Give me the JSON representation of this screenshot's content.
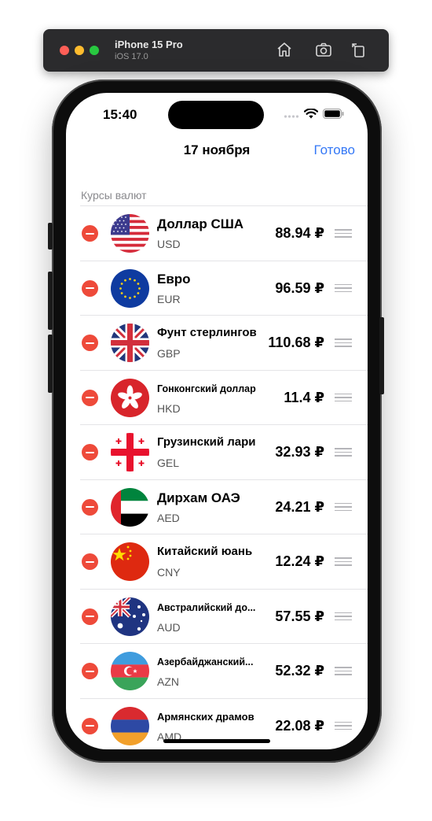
{
  "simulator": {
    "title": "iPhone 15 Pro",
    "subtitle": "iOS 17.0",
    "icons": [
      "home-icon",
      "screenshot-icon",
      "rotate-icon"
    ]
  },
  "status_bar": {
    "time": "15:40",
    "icons": [
      "signal-icon",
      "wifi-icon",
      "battery-icon"
    ]
  },
  "nav": {
    "title": "17 ноября",
    "done_label": "Готово"
  },
  "section": {
    "header": "Курсы валют"
  },
  "colors": {
    "accent": "#3478f6",
    "delete": "#ee4a3a",
    "secondary_text": "#8a8a8e"
  },
  "currencies": [
    {
      "name": "Доллар США",
      "code": "USD",
      "rate": "88.94 ₽",
      "flag": "us-flag"
    },
    {
      "name": "Евро",
      "code": "EUR",
      "rate": "96.59 ₽",
      "flag": "eu-flag"
    },
    {
      "name": "Фунт стерлингов",
      "code": "GBP",
      "rate": "110.68 ₽",
      "flag": "gb-flag"
    },
    {
      "name": "Гонконгский доллар",
      "code": "HKD",
      "rate": "11.4 ₽",
      "flag": "hk-flag"
    },
    {
      "name": "Грузинский лари",
      "code": "GEL",
      "rate": "32.93 ₽",
      "flag": "ge-flag"
    },
    {
      "name": "Дирхам ОАЭ",
      "code": "AED",
      "rate": "24.21 ₽",
      "flag": "ae-flag"
    },
    {
      "name": "Китайский юань",
      "code": "CNY",
      "rate": "12.24 ₽",
      "flag": "cn-flag"
    },
    {
      "name": "Австралийский до...",
      "code": "AUD",
      "rate": "57.55 ₽",
      "flag": "au-flag"
    },
    {
      "name": "Азербайджанский...",
      "code": "AZN",
      "rate": "52.32 ₽",
      "flag": "az-flag"
    },
    {
      "name": "Армянских драмов",
      "code": "AMD",
      "rate": "22.08 ₽",
      "flag": "am-flag"
    }
  ]
}
